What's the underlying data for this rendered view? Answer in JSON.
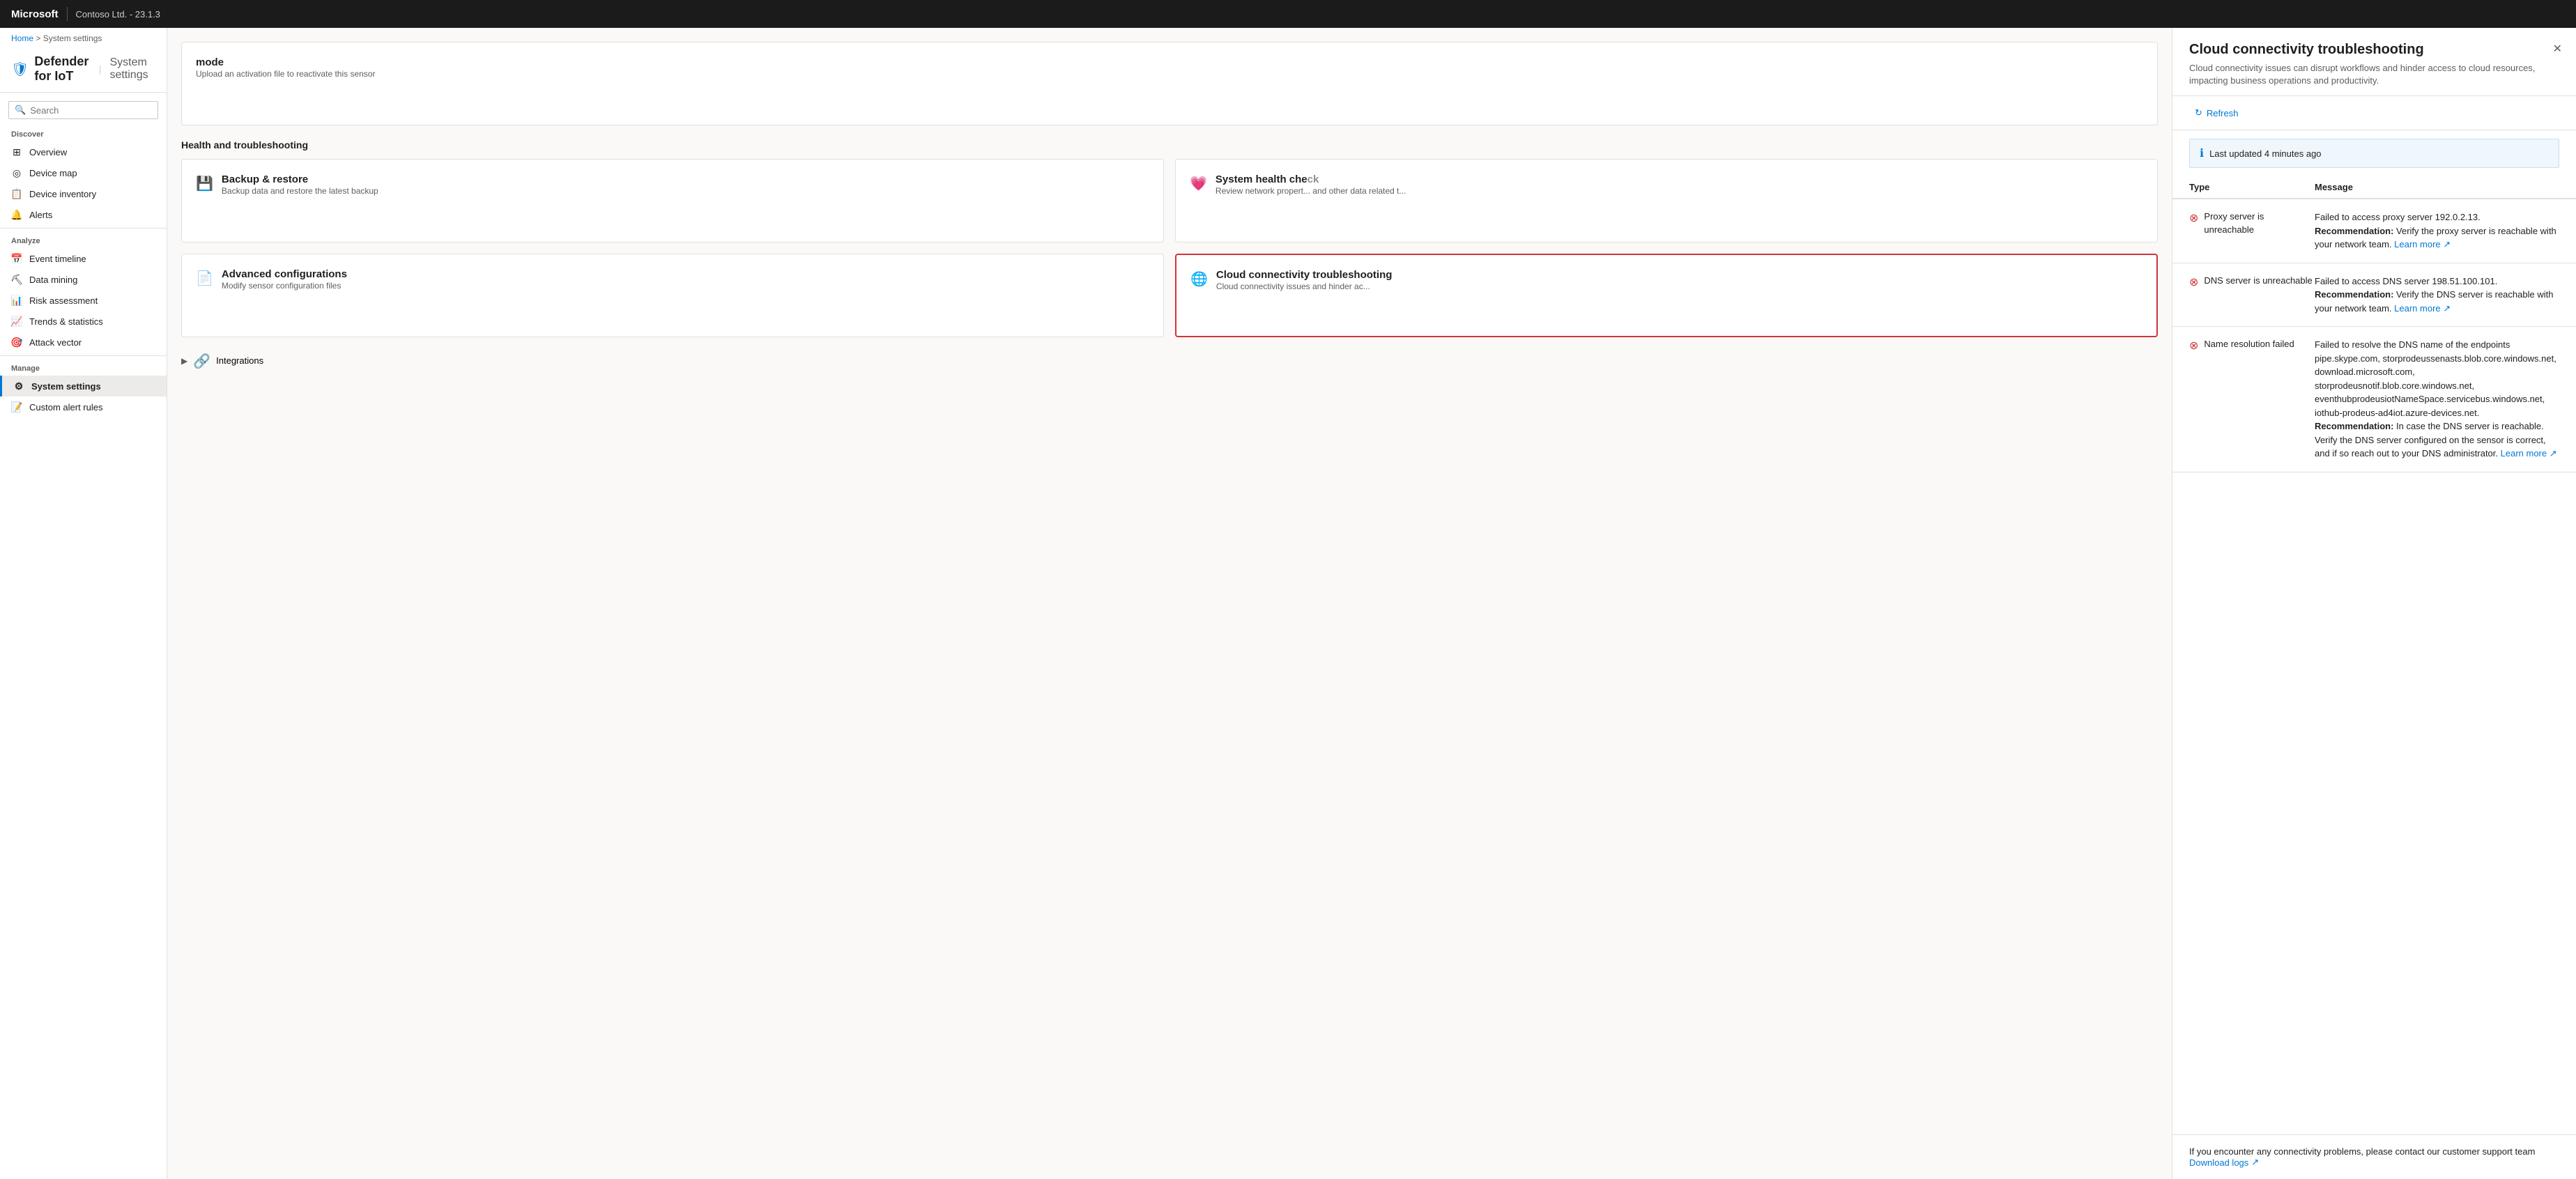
{
  "topbar": {
    "brand": "Microsoft",
    "tenant": "Contoso Ltd. - 23.1.3"
  },
  "breadcrumb": {
    "home": "Home",
    "separator": ">",
    "current": "System settings"
  },
  "pageTitle": {
    "icon": "🛡",
    "appName": "Defender for IoT",
    "separator": "|",
    "pageName": "System settings"
  },
  "search": {
    "placeholder": "Search"
  },
  "sidebar": {
    "discover_label": "Discover",
    "discover_items": [
      {
        "id": "overview",
        "label": "Overview",
        "icon": "⊞"
      },
      {
        "id": "device-map",
        "label": "Device map",
        "icon": "◎"
      },
      {
        "id": "device-inventory",
        "label": "Device inventory",
        "icon": "📋"
      },
      {
        "id": "alerts",
        "label": "Alerts",
        "icon": "🔔"
      }
    ],
    "analyze_label": "Analyze",
    "analyze_items": [
      {
        "id": "event-timeline",
        "label": "Event timeline",
        "icon": "📅"
      },
      {
        "id": "data-mining",
        "label": "Data mining",
        "icon": "⛏"
      },
      {
        "id": "risk-assessment",
        "label": "Risk assessment",
        "icon": "📊"
      },
      {
        "id": "trends-statistics",
        "label": "Trends & statistics",
        "icon": "📈"
      },
      {
        "id": "attack-vector",
        "label": "Attack vector",
        "icon": "🎯"
      }
    ],
    "manage_label": "Manage",
    "manage_items": [
      {
        "id": "system-settings",
        "label": "System settings",
        "icon": "⚙",
        "active": true
      },
      {
        "id": "custom-alert-rules",
        "label": "Custom alert rules",
        "icon": "📝"
      }
    ]
  },
  "content": {
    "modeCard": {
      "title": "mode",
      "description": "Upload an activation file to reactivate this sensor"
    },
    "healthSection": "Health and troubleshooting",
    "cards": [
      {
        "id": "backup-restore",
        "icon": "💾",
        "title": "Backup & restore",
        "description": "Backup data and restore the latest backup"
      },
      {
        "id": "system-health",
        "icon": "💗",
        "title": "System health check",
        "description": "Review network properties and other data related t..."
      },
      {
        "id": "advanced-configurations",
        "icon": "📄",
        "title": "Advanced configurations",
        "description": "Modify sensor configuration files"
      },
      {
        "id": "cloud-connectivity",
        "icon": "🌐",
        "title": "Cloud connectivity troubleshooting",
        "description": "Cloud connectivity issues and hinder ac...",
        "highlighted": true
      }
    ],
    "integrations": {
      "label": "Integrations",
      "icon": "🔗"
    }
  },
  "panel": {
    "title": "Cloud connectivity troubleshooting",
    "subtitle": "Cloud connectivity issues can disrupt workflows and hinder access to cloud resources, impacting business operations and productivity.",
    "refreshLabel": "Refresh",
    "lastUpdated": "Last updated 4 minutes ago",
    "columns": {
      "type": "Type",
      "message": "Message"
    },
    "errors": [
      {
        "id": "proxy",
        "type": "Proxy server is unreachable",
        "message": "Failed to access proxy server 192.0.2.13.",
        "recommendation": "Verify the proxy server is reachable with your network team.",
        "learnMore": "Learn more"
      },
      {
        "id": "dns",
        "type": "DNS server is unreachable",
        "message": "Failed to access DNS server 198.51.100.101.",
        "recommendation": "Verify the DNS server is reachable with your network team.",
        "learnMore": "Learn more"
      },
      {
        "id": "name-resolution",
        "type": "Name resolution failed",
        "message": "Failed to resolve the DNS name of the endpoints pipe.skype.com, storprodeussenasts.blob.core.windows.net, download.microsoft.com, storprodeusnotif.blob.core.windows.net, eventhubprodeusiotNameSpace.servicebus.windows.net, iothub-prodeus-ad4iot.azure-devices.net.",
        "recommendation": "In case the DNS server is reachable. Verify the DNS server configured on the sensor is correct, and if so reach out to your DNS administrator.",
        "learnMore": "Learn more"
      }
    ],
    "footer": {
      "text": "If you encounter any connectivity problems, please contact our customer support team",
      "downloadLogsLabel": "Download logs"
    }
  }
}
